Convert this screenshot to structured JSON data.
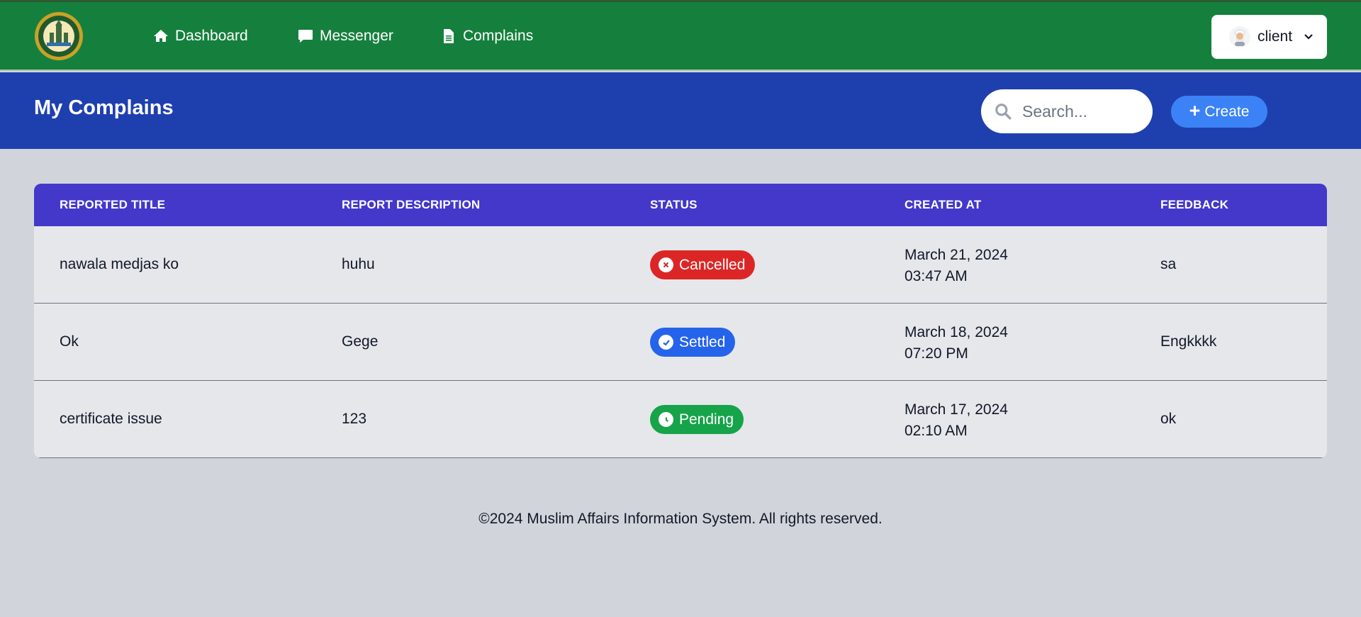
{
  "nav": {
    "logo_alt": "Muslim Affairs seal",
    "items": [
      {
        "label": "Dashboard",
        "icon": "home-icon"
      },
      {
        "label": "Messenger",
        "icon": "chat-icon"
      },
      {
        "label": "Complains",
        "icon": "document-icon"
      }
    ],
    "user": {
      "name": "client",
      "avatar": "user-avatar-icon"
    }
  },
  "header": {
    "title": "My Complains",
    "search_placeholder": "Search...",
    "create_label": "Create"
  },
  "table": {
    "columns": [
      "REPORTED TITLE",
      "REPORT DESCRIPTION",
      "STATUS",
      "CREATED AT",
      "FEEDBACK"
    ],
    "rows": [
      {
        "title": "nawala medjas ko",
        "description": "huhu",
        "status": "Cancelled",
        "status_color": "#dc2626",
        "status_icon": "x-circle-icon",
        "date": "March 21, 2024",
        "time": "03:47 AM",
        "feedback": "sa"
      },
      {
        "title": "Ok",
        "description": "Gege",
        "status": "Settled",
        "status_color": "#2563eb",
        "status_icon": "check-circle-icon",
        "date": "March 18, 2024",
        "time": "07:20 PM",
        "feedback": "Engkkkk"
      },
      {
        "title": "certificate issue",
        "description": "123",
        "status": "Pending",
        "status_color": "#16a34a",
        "status_icon": "clock-icon",
        "date": "March 17, 2024",
        "time": "02:10 AM",
        "feedback": "ok"
      }
    ]
  },
  "footer": {
    "text": "©2024 Muslim Affairs Information System. All rights reserved."
  },
  "colors": {
    "nav_bg": "#15803d",
    "header_bg": "#1e40af",
    "table_head_bg": "#4338ca",
    "create_btn": "#3b82f6",
    "page_bg": "#d1d5db"
  }
}
